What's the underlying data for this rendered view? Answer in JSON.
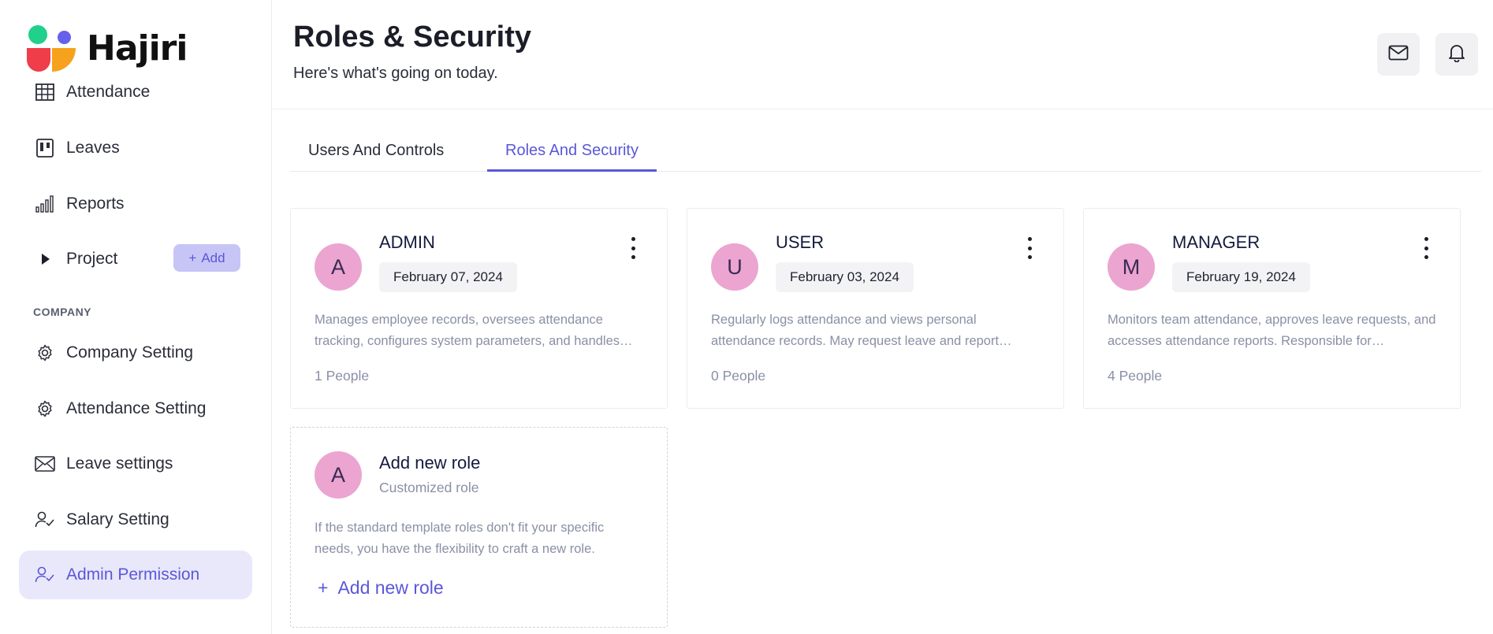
{
  "brand": {
    "name": "Hajiri"
  },
  "sidebar": {
    "items": [
      {
        "label": "Attendance",
        "icon": "table-icon"
      },
      {
        "label": "Leaves",
        "icon": "kanban-icon"
      },
      {
        "label": "Reports",
        "icon": "bar-chart-icon"
      },
      {
        "label": "Project",
        "icon": "play-icon",
        "add_label": "Add"
      },
      {
        "label": "Company Setting",
        "icon": "gear-icon"
      },
      {
        "label": "Attendance Setting",
        "icon": "gear-icon"
      },
      {
        "label": "Leave settings",
        "icon": "envelope-icon"
      },
      {
        "label": "Salary Setting",
        "icon": "user-check-icon"
      },
      {
        "label": "Admin Permission",
        "icon": "user-check-icon",
        "active": true
      }
    ],
    "section_company": "COMPANY"
  },
  "header": {
    "title": "Roles & Security",
    "subtitle": "Here's what's going on today.",
    "buttons": [
      "mail-icon",
      "bell-icon"
    ]
  },
  "tabs": [
    {
      "label": "Users And Controls",
      "active": false
    },
    {
      "label": "Roles And Security",
      "active": true
    }
  ],
  "roles": [
    {
      "initial": "A",
      "name": "ADMIN",
      "date": "February 07, 2024",
      "description": "Manages employee records, oversees attendance tracking, configures system parameters, and handles…",
      "people": "1 People"
    },
    {
      "initial": "U",
      "name": "USER",
      "date": "February 03, 2024",
      "description": "Regularly logs attendance and views personal attendance records. May request leave and report…",
      "people": "0 People"
    },
    {
      "initial": "M",
      "name": "MANAGER",
      "date": "February 19, 2024",
      "description": "Monitors team attendance, approves leave requests, and accesses attendance reports. Responsible for…",
      "people": "4 People"
    }
  ],
  "new_role": {
    "initial": "A",
    "title": "Add new role",
    "subtitle": "Customized role",
    "description": "If the standard template roles don't fit your specific needs, you have the flexibility to craft a new role.",
    "link_label": "Add new role"
  },
  "colors": {
    "accent": "#5b57d9",
    "avatar": "#eba5d0",
    "active_nav_bg": "#e9e8fb"
  }
}
